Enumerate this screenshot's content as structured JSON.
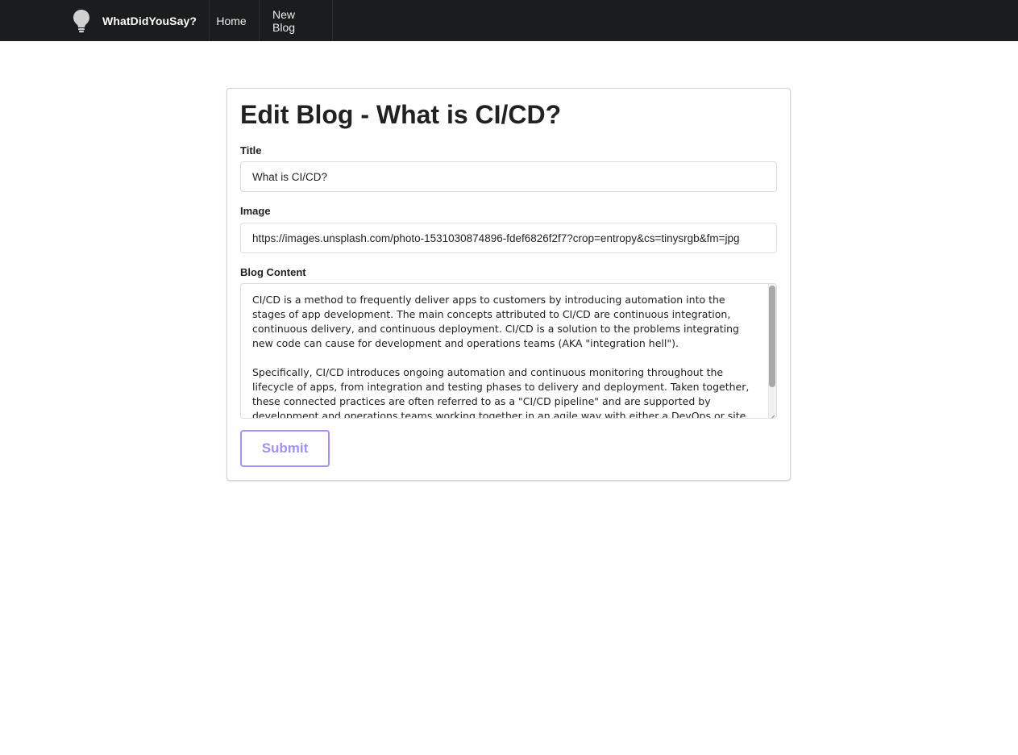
{
  "navbar": {
    "brand_icon": "lightbulb-icon",
    "brand_name": "WhatDidYouSay?",
    "items": [
      {
        "label": "Home"
      },
      {
        "label": "New Blog"
      }
    ],
    "background": "#1b1c1d"
  },
  "form": {
    "heading": "Edit Blog - What is CI/CD?",
    "title_label": "Title",
    "title_value": "What is CI/CD?",
    "image_label": "Image",
    "image_value": "https://images.unsplash.com/photo-1531030874896-fdef6826f2f7?crop=entropy&cs=tinysrgb&fm=jpg",
    "content_label": "Blog Content",
    "content_value": "CI/CD is a method to frequently deliver apps to customers by introducing automation into the stages of app development. The main concepts attributed to CI/CD are continuous integration, continuous delivery, and continuous deployment. CI/CD is a solution to the problems integrating new code can cause for development and operations teams (AKA \"integration hell\").\n\nSpecifically, CI/CD introduces ongoing automation and continuous monitoring throughout the lifecycle of apps, from integration and testing phases to delivery and deployment. Taken together, these connected practices are often referred to as a \"CI/CD pipeline\" and are supported by development and operations teams working together in an agile way with either a DevOps or site",
    "submit_label": "Submit",
    "accent_color": "#a291fb"
  }
}
